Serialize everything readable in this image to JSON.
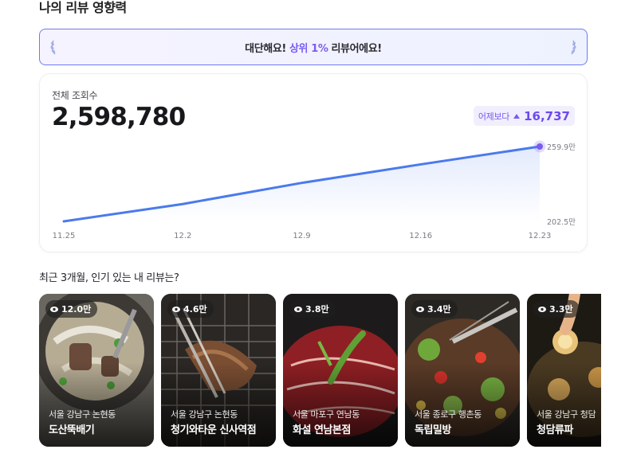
{
  "section_title": "나의 리뷰 영향력",
  "banner": {
    "prefix": "대단해요!",
    "highlight": "상위 1%",
    "suffix": "리뷰어에요!"
  },
  "stats": {
    "label": "전체 조회수",
    "total": "2,598,780",
    "delta_label": "어제보다",
    "delta_value": "16,737"
  },
  "chart_data": {
    "type": "area",
    "x": [
      "11.25",
      "12.2",
      "12.9",
      "12.16",
      "12.23"
    ],
    "values": [
      202.5,
      215.8,
      232.0,
      246.2,
      259.9
    ],
    "unit": "만",
    "y_labels": [
      "259.9만",
      "202.5만"
    ],
    "ylim": [
      202.5,
      259.9
    ],
    "grid": false,
    "color": "#4a7aec"
  },
  "subhead": "최근 3개월, 인기 있는 내 리뷰는?",
  "reviews": [
    {
      "views": "12.0만",
      "location": "서울 강남구 논현동",
      "name": "도산뚝배기"
    },
    {
      "views": "4.6만",
      "location": "서울 강남구 논현동",
      "name": "청기와타운 신사역점"
    },
    {
      "views": "3.8만",
      "location": "서울 마포구 연남동",
      "name": "화설 연남본점"
    },
    {
      "views": "3.4만",
      "location": "서울 종로구 행촌동",
      "name": "독립밀방"
    },
    {
      "views": "3.3만",
      "location": "서울 강남구 청담",
      "name": "청담류파"
    }
  ]
}
